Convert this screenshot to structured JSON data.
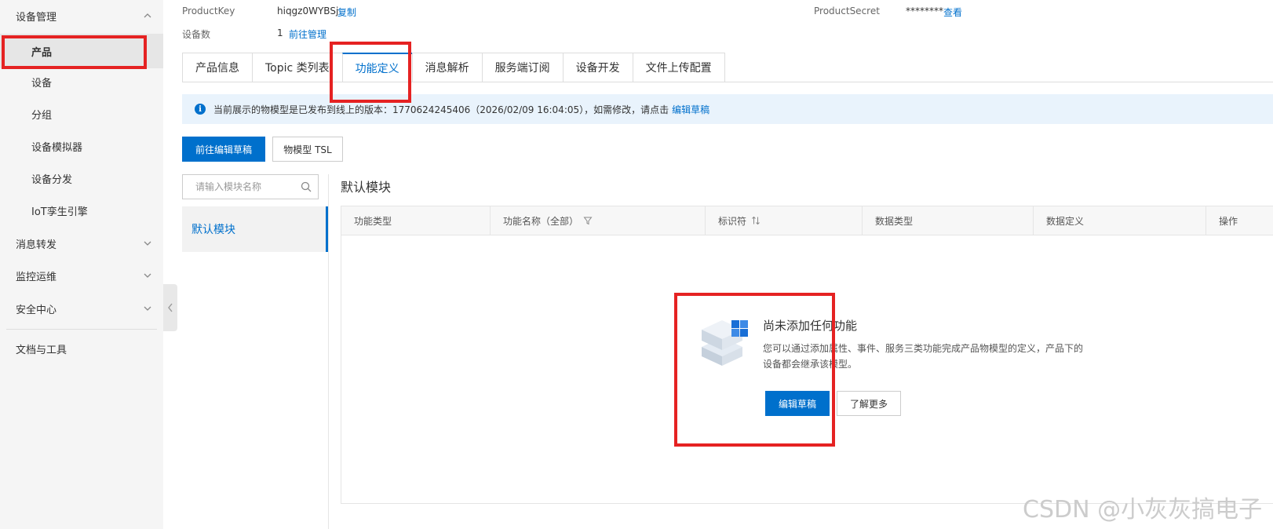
{
  "sidebar": {
    "groups": [
      {
        "label": "设备管理"
      },
      {
        "label": "消息转发"
      },
      {
        "label": "监控运维"
      },
      {
        "label": "安全中心"
      },
      {
        "label": "文档与工具"
      }
    ],
    "items": [
      {
        "label": "产品"
      },
      {
        "label": "设备"
      },
      {
        "label": "分组"
      },
      {
        "label": "设备模拟器"
      },
      {
        "label": "设备分发"
      },
      {
        "label": "IoT孪生引擎"
      }
    ]
  },
  "product_info": {
    "product_key_label": "ProductKey",
    "product_key_value": "hiqgz0WYBSj",
    "copy_label": "复制",
    "product_secret_label": "ProductSecret",
    "product_secret_value": "********",
    "view_label": "查看",
    "device_count_label": "设备数",
    "device_count_value": "1",
    "manage_label": "前往管理"
  },
  "tabs": [
    {
      "label": "产品信息"
    },
    {
      "label": "Topic 类列表"
    },
    {
      "label": "功能定义"
    },
    {
      "label": "消息解析"
    },
    {
      "label": "服务端订阅"
    },
    {
      "label": "设备开发"
    },
    {
      "label": "文件上传配置"
    }
  ],
  "notice": {
    "text": "当前展示的物模型是已发布到线上的版本：1770624245406（2026/02/09 16:04:05），如需修改，请点击",
    "link": "编辑草稿"
  },
  "toolbar": {
    "edit_draft_label": "前往编辑草稿",
    "tsl_label": "物模型 TSL"
  },
  "module_search": {
    "placeholder": "请输入模块名称"
  },
  "modules": [
    {
      "label": "默认模块"
    }
  ],
  "module_title": "默认模块",
  "table": {
    "columns": [
      "功能类型",
      "功能名称（全部）",
      "标识符",
      "数据类型",
      "数据定义",
      "操作"
    ]
  },
  "empty_state": {
    "title": "尚未添加任何功能",
    "description": "您可以通过添加属性、事件、服务三类功能完成产品物模型的定义，产品下的设备都会继承该模型。",
    "edit_button": "编辑草稿",
    "learn_more_button": "了解更多"
  },
  "watermark": "CSDN @小灰灰搞电子",
  "colors": {
    "accent": "#0070cc",
    "highlight": "#e52222",
    "notice_bg": "#e9f3fc"
  }
}
